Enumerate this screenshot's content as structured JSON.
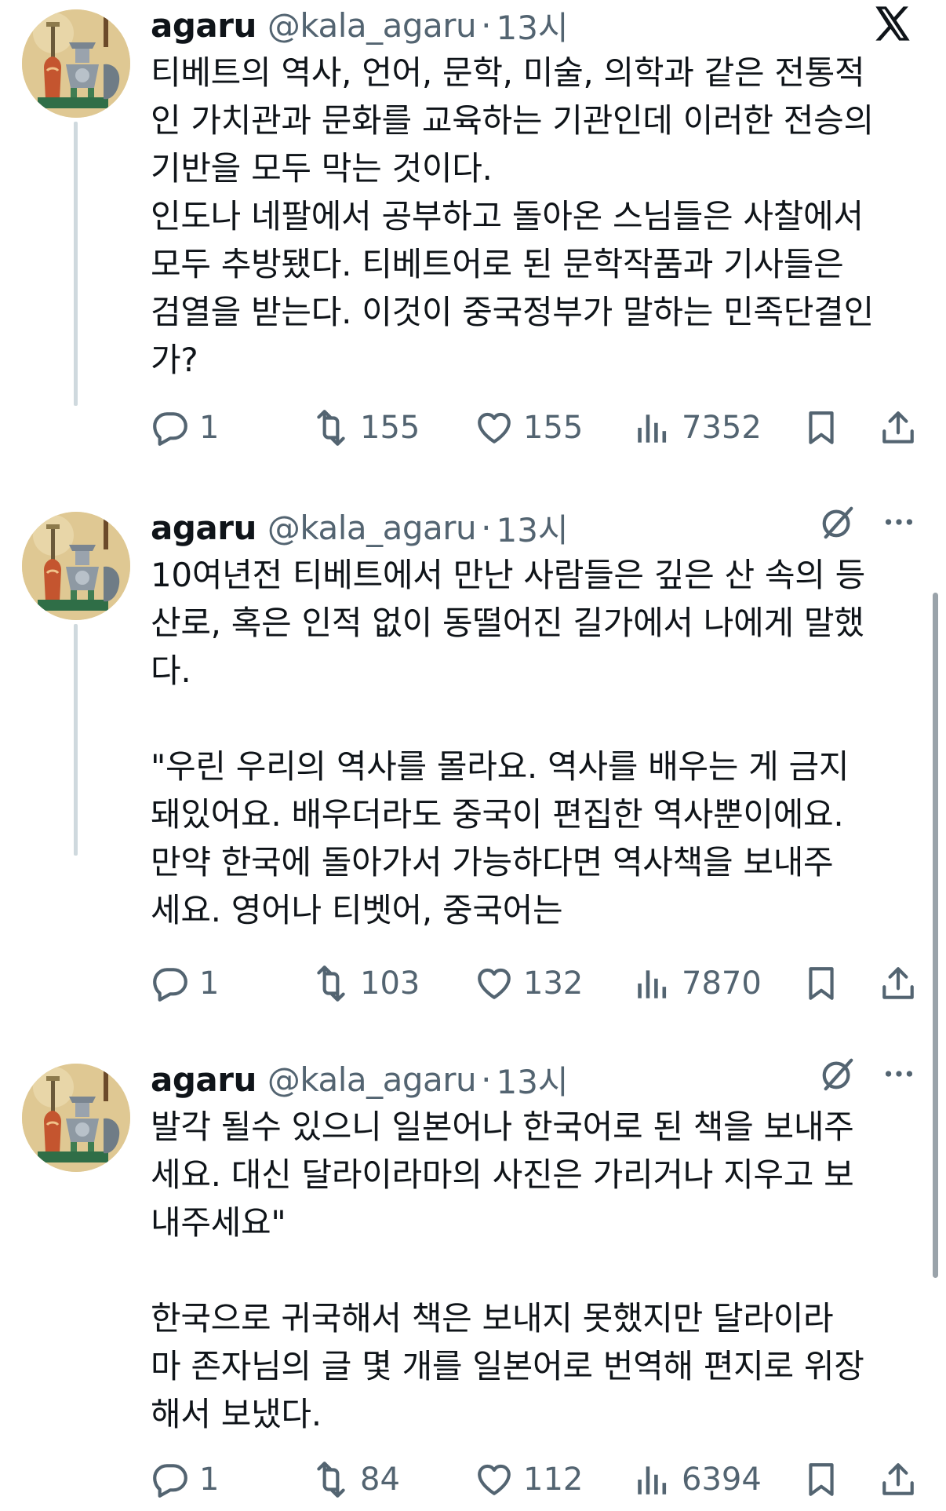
{
  "tweets": [
    {
      "name": "agaru",
      "handle": "@kala_agaru",
      "separator": "·",
      "time": "13시",
      "text": "티베트의 역사, 언어, 문학, 미술, 의학과 같은 전통적\n인 가치관과 문화를 교육하는 기관인데 이러한 전승의\n기반을 모두 막는 것이다.\n인도나 네팔에서 공부하고 돌아온 스님들은 사찰에서\n모두 추방됐다. 티베트어로 된 문학작품과 기사들은\n검열을 받는다. 이것이 중국정부가 말하는 민족단결인\n가?",
      "replies": "1",
      "reposts": "155",
      "likes": "155",
      "views": "7352"
    },
    {
      "name": "agaru",
      "handle": "@kala_agaru",
      "separator": "·",
      "time": "13시",
      "text": "10여년전 티베트에서 만난 사람들은 깊은 산 속의 등\n산로, 혹은 인적 없이 동떨어진 길가에서 나에게 말했\n다.\n\n\"우린 우리의 역사를 몰라요. 역사를 배우는 게 금지\n돼있어요. 배우더라도 중국이 편집한 역사뿐이에요.\n만약 한국에 돌아가서 가능하다면 역사책을 보내주\n세요. 영어나 티벳어, 중국어는",
      "replies": "1",
      "reposts": "103",
      "likes": "132",
      "views": "7870"
    },
    {
      "name": "agaru",
      "handle": "@kala_agaru",
      "separator": "·",
      "time": "13시",
      "text": "발각 될수 있으니 일본어나 한국어로 된 책을 보내주\n세요. 대신 달라이라마의 사진은 가리거나 지우고 보\n내주세요\"\n\n한국으로 귀국해서 책은 보내지 못했지만 달라이라\n마 존자님의 글 몇 개를 일본어로 번역해 편지로 위장\n해서 보냈다.",
      "replies": "1",
      "reposts": "84",
      "likes": "112",
      "views": "6394"
    }
  ],
  "icons": {
    "platform": "x-logo-icon",
    "grok": "grok-icon",
    "more": "more-icon",
    "reply": "reply-icon",
    "repost": "repost-icon",
    "like": "heart-icon",
    "views": "views-icon",
    "bookmark": "bookmark-icon",
    "share": "share-icon"
  },
  "colors": {
    "text": "#0f1419",
    "muted": "#536471",
    "thread_line": "#cfd9de",
    "background": "#ffffff"
  }
}
